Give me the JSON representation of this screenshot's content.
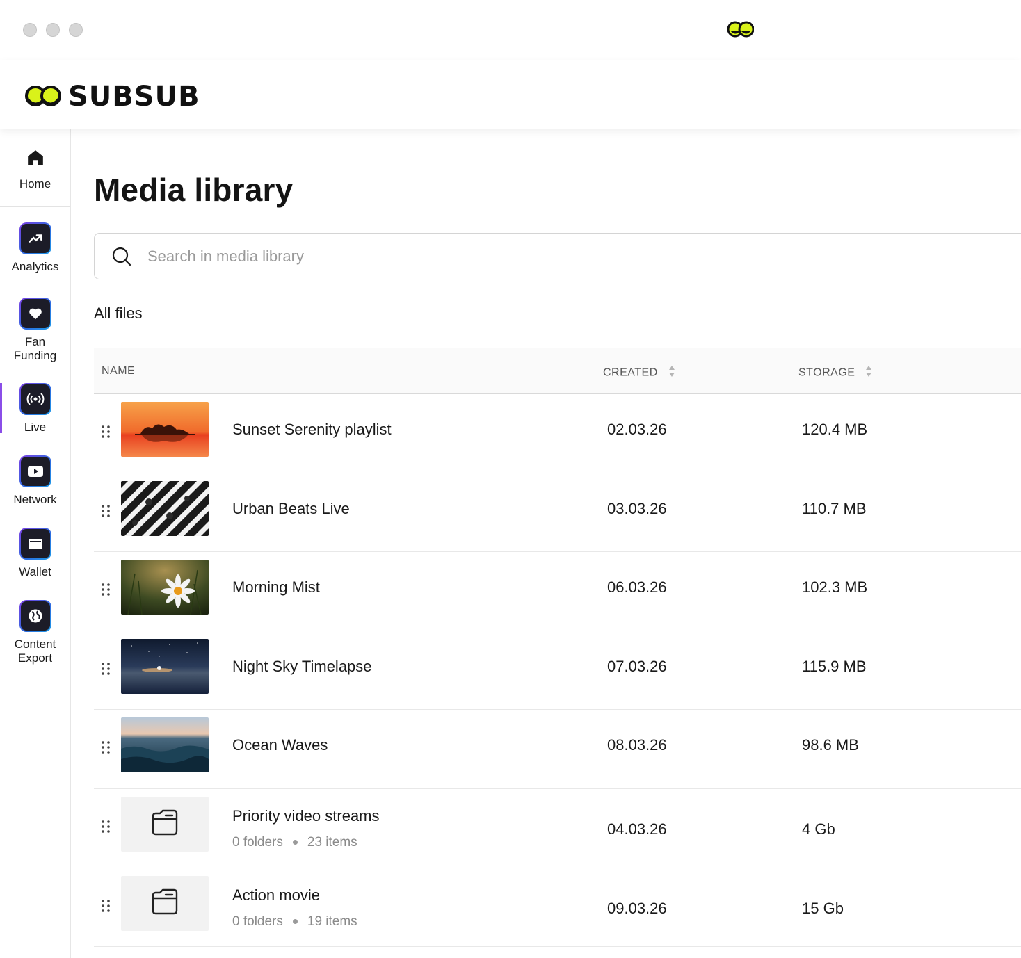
{
  "app": {
    "brand": "SUBSUB",
    "accent_color": "#d9f21a",
    "nav_accent": "#8a4de8"
  },
  "sidebar": {
    "home": {
      "label": "Home",
      "icon": "home-icon"
    },
    "items": [
      {
        "label": "Analytics",
        "icon": "trending-up-icon"
      },
      {
        "label_line1": "Fan",
        "label_line2": "Funding",
        "icon": "heart-icon"
      },
      {
        "label": "Live",
        "icon": "broadcast-icon",
        "active": true
      },
      {
        "label": "Network",
        "icon": "youtube-icon"
      },
      {
        "label": "Wallet",
        "icon": "wallet-icon"
      },
      {
        "label_line1": "Content",
        "label_line2": "Export",
        "icon": "globe-icon"
      }
    ]
  },
  "main": {
    "title": "Media library",
    "search": {
      "placeholder": "Search in media library",
      "value": ""
    },
    "section_title": "All files",
    "table": {
      "columns": {
        "name": "NAME",
        "created": "CREATED",
        "storage": "STORAGE"
      },
      "rows": [
        {
          "name": "Sunset Serenity playlist",
          "created": "02.03.26",
          "storage": "120.4 MB",
          "thumb": "sunset"
        },
        {
          "name": "Urban Beats Live",
          "created": "03.03.26",
          "storage": "110.7 MB",
          "thumb": "crosswalk"
        },
        {
          "name": "Morning Mist",
          "created": "06.03.26",
          "storage": "102.3 MB",
          "thumb": "daisy"
        },
        {
          "name": "Night Sky Timelapse",
          "created": "07.03.26",
          "storage": "115.9 MB",
          "thumb": "nightsky"
        },
        {
          "name": "Ocean Waves",
          "created": "08.03.26",
          "storage": "98.6 MB",
          "thumb": "ocean"
        },
        {
          "name": "Priority video streams",
          "folders": "0 folders",
          "items": "23 items",
          "created": "04.03.26",
          "storage": "4 Gb",
          "thumb": "folder"
        },
        {
          "name": "Action movie",
          "folders": "0 folders",
          "items": "19 items",
          "created": "09.03.26",
          "storage": "15 Gb",
          "thumb": "folder"
        }
      ]
    }
  }
}
